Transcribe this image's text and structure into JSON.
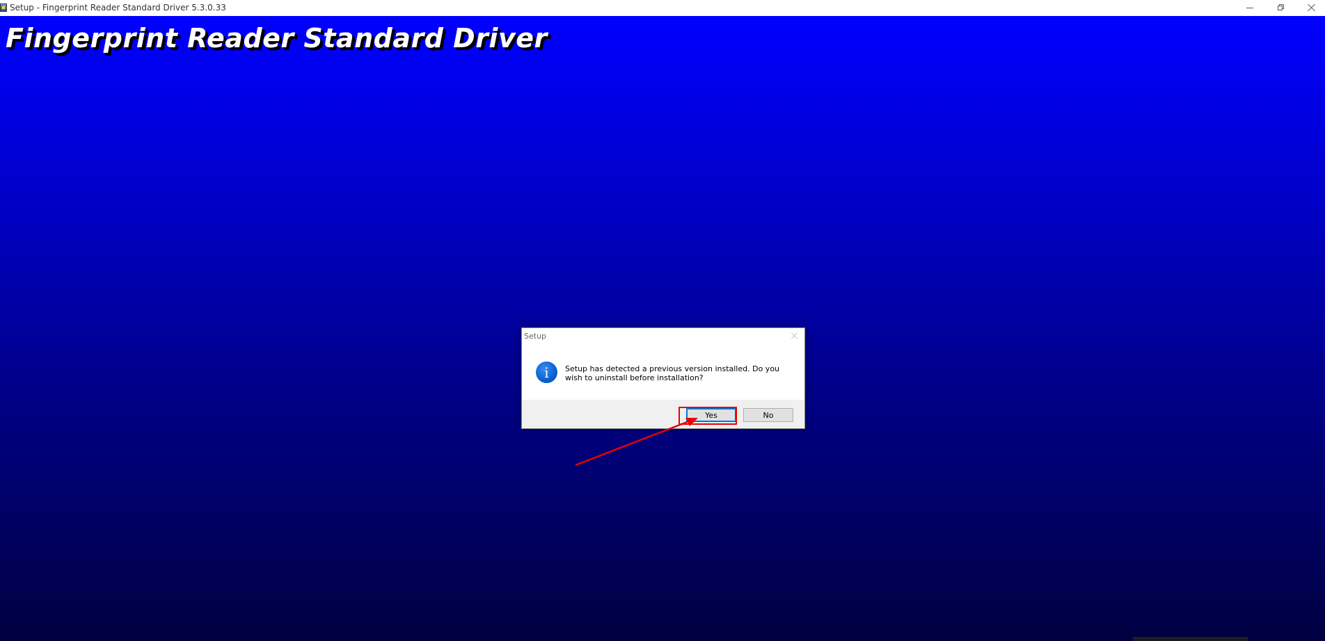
{
  "window": {
    "title": "Setup - Fingerprint Reader Standard Driver 5.3.0.33",
    "icon": "setup-app-icon"
  },
  "stage": {
    "heading": "Fingerprint Reader Standard Driver",
    "colors": {
      "gradient_top": "#0000ff",
      "gradient_bottom": "#000040"
    }
  },
  "dialog": {
    "title": "Setup",
    "icon": "info-icon",
    "icon_glyph": "i",
    "message": "Setup has detected a previous version installed. Do you wish to uninstall before installation?",
    "buttons": {
      "yes": "Yes",
      "no": "No"
    }
  },
  "annotation": {
    "color": "#e80000",
    "target": "yes-button"
  }
}
